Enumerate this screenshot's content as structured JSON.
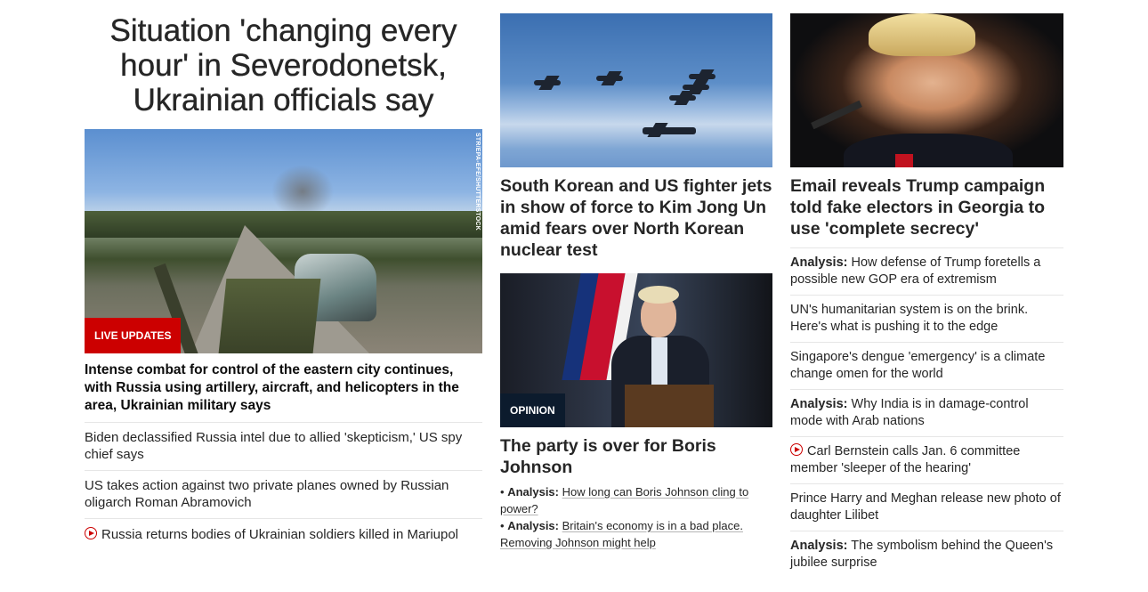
{
  "left": {
    "hero_title": "Situation 'changing every hour' in Severodonetsk, Ukrainian officials say",
    "photo_credit": "STR/EPA-EFE/SHUTTERSTOCK",
    "badge": "LIVE UPDATES",
    "hero_desc": "Intense combat for control of the eastern city continues, with Russia using artillery, aircraft, and helicopters in the area, Ukrainian military says",
    "stories": [
      {
        "text": "Biden declassified Russia intel due to allied 'skepticism,' US spy chief says"
      },
      {
        "text": "US takes action against two private planes owned by Russian oligarch Roman Abramovich"
      },
      {
        "text": "Russia returns bodies of Ukrainian soldiers killed in Mariupol",
        "icon": "play-icon"
      }
    ]
  },
  "middle": {
    "headline": "South Korean and US fighter jets in show of force to Kim Jong Un amid fears over North Korean nuclear test",
    "badge": "OPINION",
    "headline2": "The party is over for Boris Johnson",
    "links": [
      {
        "prefix": "Analysis:",
        "text": "How long can Boris Johnson cling to power?"
      },
      {
        "prefix": "Analysis:",
        "text": "Britain's economy is in a bad place. Removing Johnson might help"
      }
    ],
    "bullet": "•"
  },
  "right": {
    "headline": "Email reveals Trump campaign told fake electors in Georgia to use 'complete secrecy'",
    "stories": [
      {
        "prefix": "Analysis:",
        "text": "How defense of Trump foretells a possible new GOP era of extremism"
      },
      {
        "prefix": "",
        "text": "UN's humanitarian system is on the brink. Here's what is pushing it to the edge"
      },
      {
        "prefix": "",
        "text": "Singapore's dengue 'emergency' is a climate change omen for the world"
      },
      {
        "prefix": "Analysis:",
        "text": "Why India is in damage-control mode with Arab nations"
      },
      {
        "prefix": "",
        "text": "Carl Bernstein calls Jan. 6 committee member 'sleeper of the hearing'",
        "icon": "play-icon"
      },
      {
        "prefix": "",
        "text": "Prince Harry and Meghan release new photo of daughter Lilibet"
      },
      {
        "prefix": "Analysis:",
        "text": "The symbolism behind the Queen's jubilee surprise"
      }
    ]
  },
  "colors": {
    "accent_red": "#cc0000",
    "opinion_navy": "#0c1b2d",
    "text": "#262626"
  }
}
